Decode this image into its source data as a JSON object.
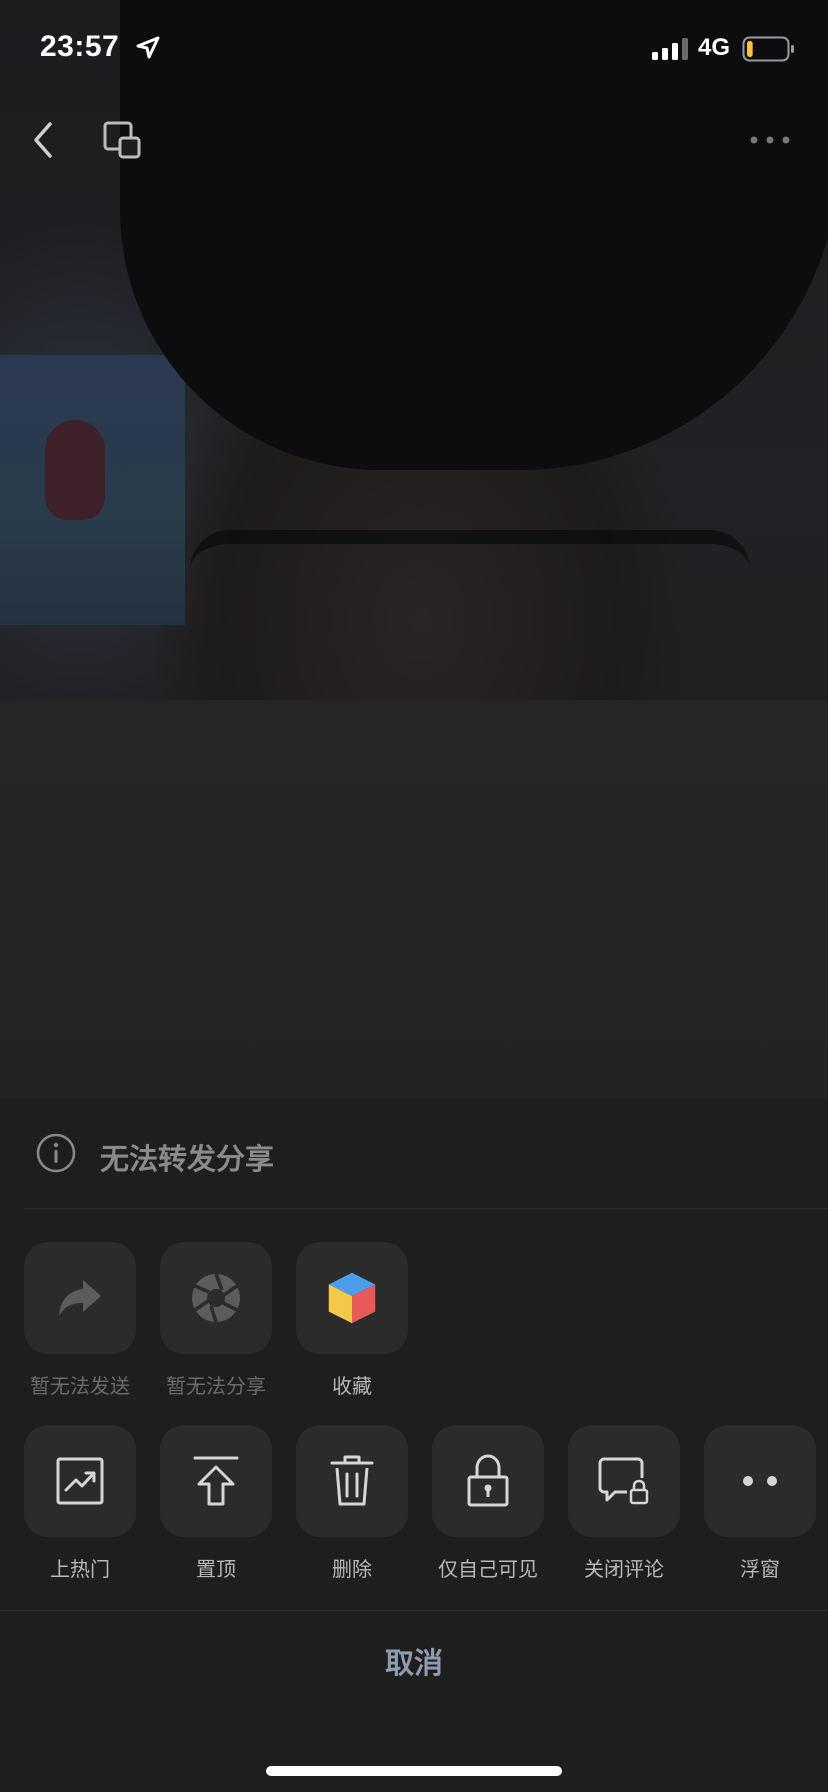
{
  "status_bar": {
    "time": "23:57",
    "network": "4G",
    "battery_level": 0.15,
    "battery_color": "#f5c443"
  },
  "nav": {
    "back_icon": "chevron-left-icon",
    "window_icon": "floating-window-icon",
    "more_icon": "more-dots-icon"
  },
  "notice": {
    "icon": "info-icon",
    "text": "无法转发分享"
  },
  "share_actions": [
    {
      "label": "暂无法发送",
      "icon": "share-arrow-icon",
      "enabled": false
    },
    {
      "label": "暂无法分享",
      "icon": "aperture-icon",
      "enabled": false
    },
    {
      "label": "收藏",
      "icon": "cube-favorite-icon",
      "enabled": true
    }
  ],
  "manage_actions": [
    {
      "label": "上热门",
      "icon": "trending-icon"
    },
    {
      "label": "置顶",
      "icon": "pin-top-icon"
    },
    {
      "label": "删除",
      "icon": "trash-icon"
    },
    {
      "label": "仅自己可见",
      "icon": "lock-icon"
    },
    {
      "label": "关闭评论",
      "icon": "comment-lock-icon"
    },
    {
      "label": "浮窗",
      "icon": "float-dots-icon"
    }
  ],
  "cancel_label": "取消",
  "colors": {
    "sheet_bg": "#1e1e1e",
    "tile_bg": "#2b2b2b",
    "cancel_text": "#8f9bb0",
    "cube_blue": "#4a9eea",
    "cube_yellow": "#f3c94a",
    "cube_red": "#e85a5a"
  }
}
